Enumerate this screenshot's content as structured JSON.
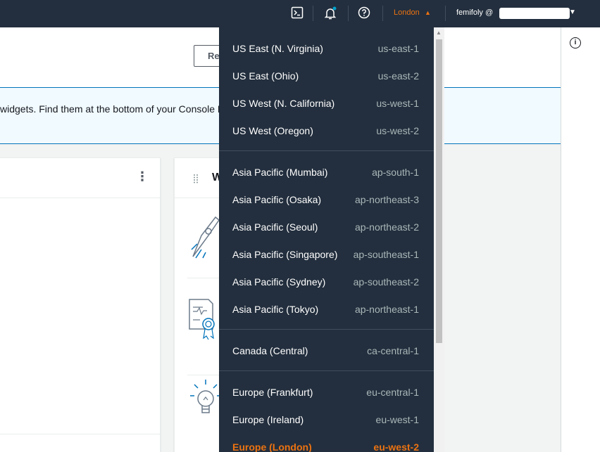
{
  "topnav": {
    "region_label": "London",
    "account_label": "femifoly @"
  },
  "icons": {
    "cloudshell": "terminal-icon",
    "notifications": "bell-icon",
    "support": "question-icon",
    "region_caret": "caret-up-icon",
    "account_caret": "caret-down-icon",
    "info": "info-icon"
  },
  "colors": {
    "nav_bg": "#232f3e",
    "accent": "#ec7211",
    "dot": "#00a1c9"
  },
  "page": {
    "reset_button_label": "Re",
    "banner_text": "widgets. Find them at the bottom of your Console H",
    "widget_title": "W"
  },
  "regions": {
    "groups": [
      {
        "items": [
          {
            "name": "US East (N. Virginia)",
            "code": "us-east-1"
          },
          {
            "name": "US East (Ohio)",
            "code": "us-east-2"
          },
          {
            "name": "US West (N. California)",
            "code": "us-west-1"
          },
          {
            "name": "US West (Oregon)",
            "code": "us-west-2"
          }
        ]
      },
      {
        "items": [
          {
            "name": "Asia Pacific (Mumbai)",
            "code": "ap-south-1"
          },
          {
            "name": "Asia Pacific (Osaka)",
            "code": "ap-northeast-3"
          },
          {
            "name": "Asia Pacific (Seoul)",
            "code": "ap-northeast-2"
          },
          {
            "name": "Asia Pacific (Singapore)",
            "code": "ap-southeast-1"
          },
          {
            "name": "Asia Pacific (Sydney)",
            "code": "ap-southeast-2"
          },
          {
            "name": "Asia Pacific (Tokyo)",
            "code": "ap-northeast-1"
          }
        ]
      },
      {
        "items": [
          {
            "name": "Canada (Central)",
            "code": "ca-central-1"
          }
        ]
      },
      {
        "items": [
          {
            "name": "Europe (Frankfurt)",
            "code": "eu-central-1"
          },
          {
            "name": "Europe (Ireland)",
            "code": "eu-west-1"
          },
          {
            "name": "Europe (London)",
            "code": "eu-west-2",
            "selected": true
          }
        ]
      }
    ]
  }
}
